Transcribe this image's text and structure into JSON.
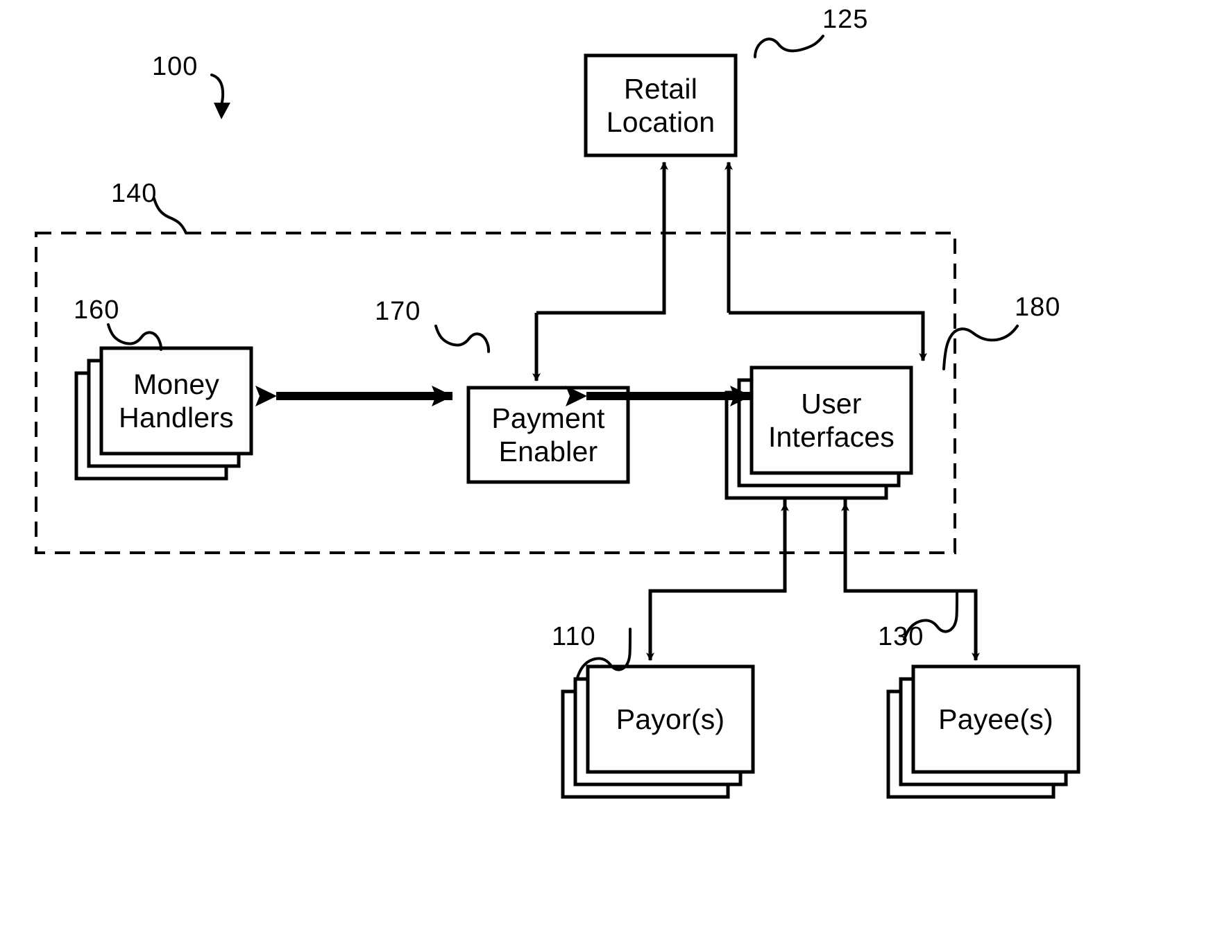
{
  "figure": {
    "type": "patent-block-diagram",
    "background_color": "#ffffff",
    "line_color": "#000000",
    "system_ref": "100"
  },
  "nodes": {
    "retail_location": {
      "label": "Retail\nLocation",
      "ref": "125",
      "stacked": false
    },
    "money_handlers": {
      "label": "Money\nHandlers",
      "ref": "160",
      "stacked": true
    },
    "payment_enabler": {
      "label": "Payment\nEnabler",
      "ref": "170",
      "stacked": false
    },
    "user_interfaces": {
      "label": "User\nInterfaces",
      "ref": "180",
      "stacked": true
    },
    "payors": {
      "label": "Payor(s)",
      "ref": "110",
      "stacked": true
    },
    "payees": {
      "label": "Payee(s)",
      "ref": "130",
      "stacked": true
    }
  },
  "boundary": {
    "ref": "140",
    "style": "dashed",
    "name": "system-boundary"
  },
  "refs": {
    "system": "100",
    "retail_location": "125",
    "boundary": "140",
    "money_handlers": "160",
    "payment_enabler": "170",
    "user_interfaces": "180",
    "payors": "110",
    "payees": "130"
  },
  "connectors": [
    {
      "name": "payment-enabler-to-retail-location",
      "from": "payment_enabler",
      "to": "retail_location",
      "arrow": "single-up"
    },
    {
      "name": "user-interfaces-to-retail-location",
      "from": "user_interfaces",
      "to": "retail_location",
      "arrow": "single-up"
    },
    {
      "name": "retail-location-to-payment-enabler",
      "from": "retail_location",
      "to": "payment_enabler",
      "arrow": "single-down"
    },
    {
      "name": "retail-location-to-user-interfaces",
      "from": "retail_location",
      "to": "user_interfaces",
      "arrow": "single-down"
    },
    {
      "name": "money-handlers-payment-enabler",
      "from": "money_handlers",
      "to": "payment_enabler",
      "arrow": "double"
    },
    {
      "name": "payment-enabler-user-interfaces",
      "from": "payment_enabler",
      "to": "user_interfaces",
      "arrow": "double"
    },
    {
      "name": "user-interfaces-to-payors",
      "from": "user_interfaces",
      "to": "payors",
      "arrow": "single-down"
    },
    {
      "name": "user-interfaces-to-payees",
      "from": "user_interfaces",
      "to": "payees",
      "arrow": "single-down"
    }
  ]
}
